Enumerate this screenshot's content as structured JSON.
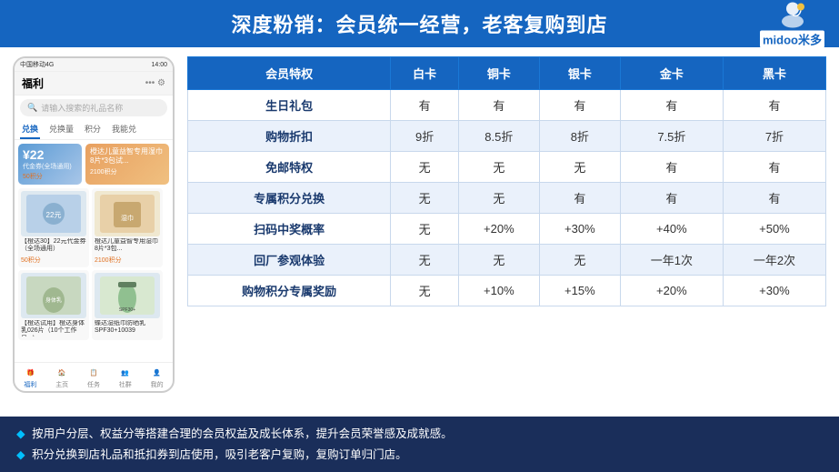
{
  "header": {
    "title": "深度粉销：会员统一经营，老客复购到店"
  },
  "logo": {
    "text": "midoo米多",
    "alt": "midoo logo"
  },
  "phone": {
    "status_bar": {
      "carrier": "中国移动4G",
      "time": "14:00",
      "battery": "□"
    },
    "nav_title": "福利",
    "search_placeholder": "请输入搜索的礼品名称",
    "tabs": [
      "兑换",
      "兑换量",
      "积分",
      "我能兑"
    ],
    "active_tab": "兑换",
    "vouchers": [
      {
        "price": "¥22",
        "sub": "代金券（全场通用）",
        "points": "50积分"
      },
      {
        "price": "",
        "sub": "儿童益智专用湿巾8片*3包试...",
        "points": "2100积分"
      }
    ],
    "products": [
      {
        "name": "【橙达30】22元代金券（全场通用）",
        "points": "50积分"
      },
      {
        "name": "蝶达儿童益智专用湿巾8片*3包试...",
        "points": "2100积分"
      },
      {
        "name": "【橙达试用】橙达身体乳026片（10个工作日...)",
        "points": ""
      },
      {
        "name": "蝶达湿纸巾防晒乳SPF30+10039",
        "points": ""
      }
    ],
    "bottom_nav": [
      "福利",
      "主页",
      "任务",
      "社群",
      "我的"
    ]
  },
  "table": {
    "headers": [
      "会员特权",
      "白卡",
      "铜卡",
      "银卡",
      "金卡",
      "黑卡"
    ],
    "rows": [
      {
        "feature": "生日礼包",
        "white": "有",
        "bronze": "有",
        "silver": "有",
        "gold": "有",
        "black": "有"
      },
      {
        "feature": "购物折扣",
        "white": "9折",
        "bronze": "8.5折",
        "silver": "8折",
        "gold": "7.5折",
        "black": "7折"
      },
      {
        "feature": "免邮特权",
        "white": "无",
        "bronze": "无",
        "silver": "无",
        "gold": "有",
        "black": "有"
      },
      {
        "feature": "专属积分兑换",
        "white": "无",
        "bronze": "无",
        "silver": "有",
        "gold": "有",
        "black": "有"
      },
      {
        "feature": "扫码中奖概率",
        "white": "无",
        "bronze": "+20%",
        "silver": "+30%",
        "gold": "+40%",
        "black": "+50%"
      },
      {
        "feature": "回厂参观体验",
        "white": "无",
        "bronze": "无",
        "silver": "无",
        "gold": "一年1次",
        "black": "一年2次"
      },
      {
        "feature": "购物积分专属奖励",
        "white": "无",
        "bronze": "+10%",
        "silver": "+15%",
        "gold": "+20%",
        "black": "+30%"
      }
    ]
  },
  "footer": {
    "bullets": [
      "按用户分层、权益分等搭建合理的会员权益及成长体系，提升会员荣誉感及成就感。",
      "积分兑换到店礼品和抵扣券到店使用，吸引老客户复购，复购订单归门店。"
    ]
  }
}
